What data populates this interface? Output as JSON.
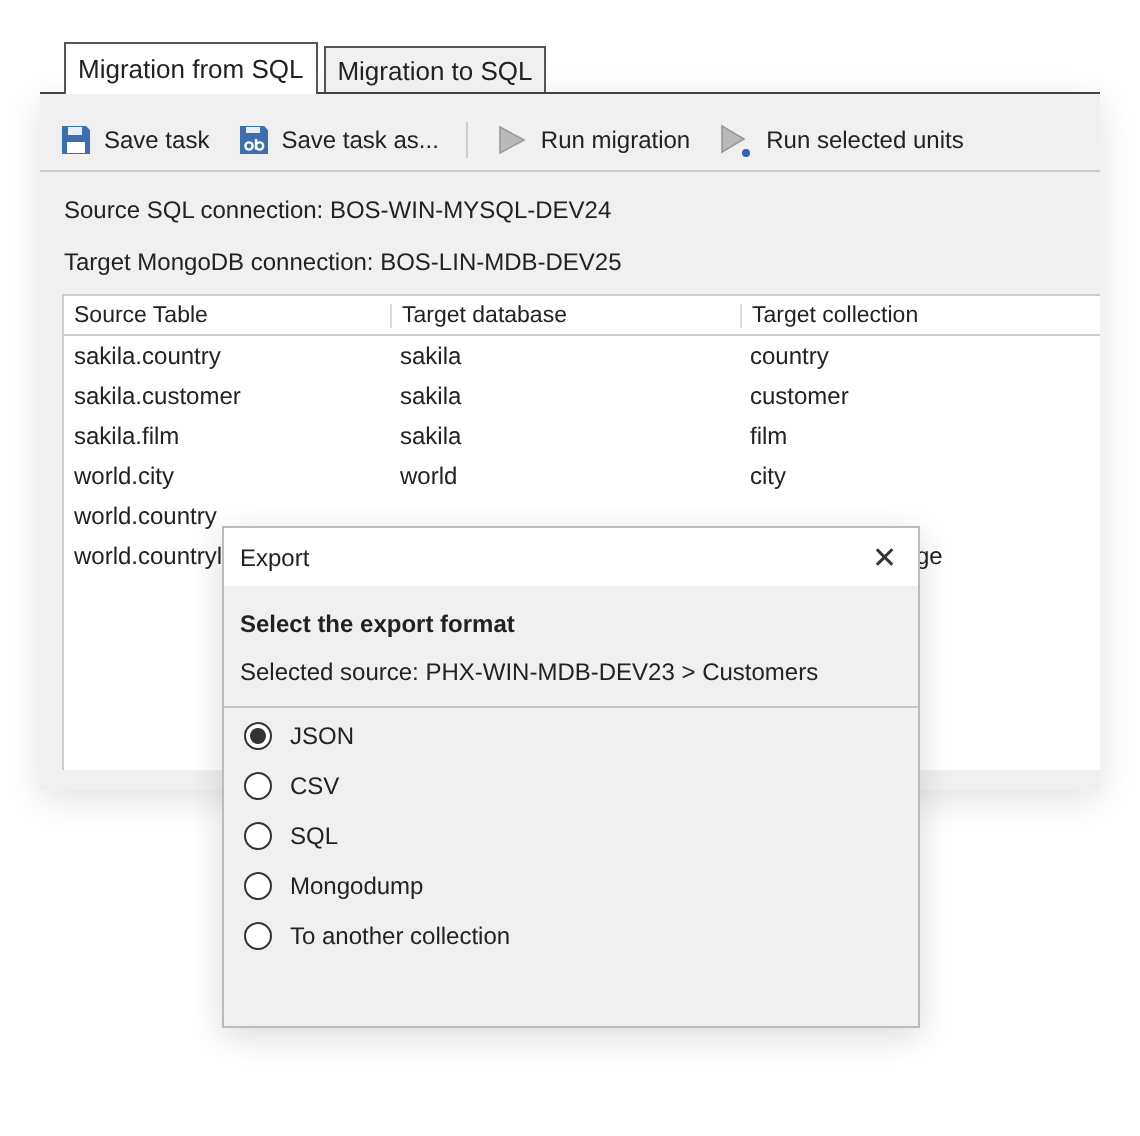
{
  "tabs": [
    {
      "label": "Migration from SQL",
      "selected": true
    },
    {
      "label": "Migration to SQL",
      "selected": false
    }
  ],
  "toolbar": [
    {
      "kind": "save",
      "label": "Save task"
    },
    {
      "kind": "save_as",
      "label": "Save task as..."
    },
    {
      "kind": "separator"
    },
    {
      "kind": "run",
      "label": "Run migration"
    },
    {
      "kind": "run_selected",
      "label": "Run selected units"
    }
  ],
  "connections": [
    "Source SQL connection: BOS-WIN-MYSQL-DEV24",
    "Target MongoDB connection: BOS-LIN-MDB-DEV25"
  ],
  "table": {
    "columns": [
      "Source Table",
      "Target database",
      "Target collection"
    ],
    "rows": [
      {
        "source_table": "sakila.country",
        "target_database": "sakila",
        "target_collection": "country"
      },
      {
        "source_table": "sakila.customer",
        "target_database": "sakila",
        "target_collection": "customer"
      },
      {
        "source_table": "sakila.film",
        "target_database": "sakila",
        "target_collection": "film"
      },
      {
        "source_table": "world.city",
        "target_database": "world",
        "target_collection": "city"
      },
      {
        "source_table": "world.country"
      },
      {
        "source_table": "world.countryl",
        "target_collection_tail": "ge"
      }
    ]
  },
  "dialog": {
    "title": "Export",
    "close": "✕",
    "heading": "Select the export format",
    "source": "Selected source: PHX-WIN-MDB-DEV23 > Customers",
    "options": [
      {
        "label": "JSON",
        "selected": true
      },
      {
        "label": "CSV",
        "selected": false
      },
      {
        "label": "SQL",
        "selected": false
      },
      {
        "label": "Mongodump",
        "selected": false
      },
      {
        "label": "To another collection",
        "selected": false
      }
    ]
  }
}
